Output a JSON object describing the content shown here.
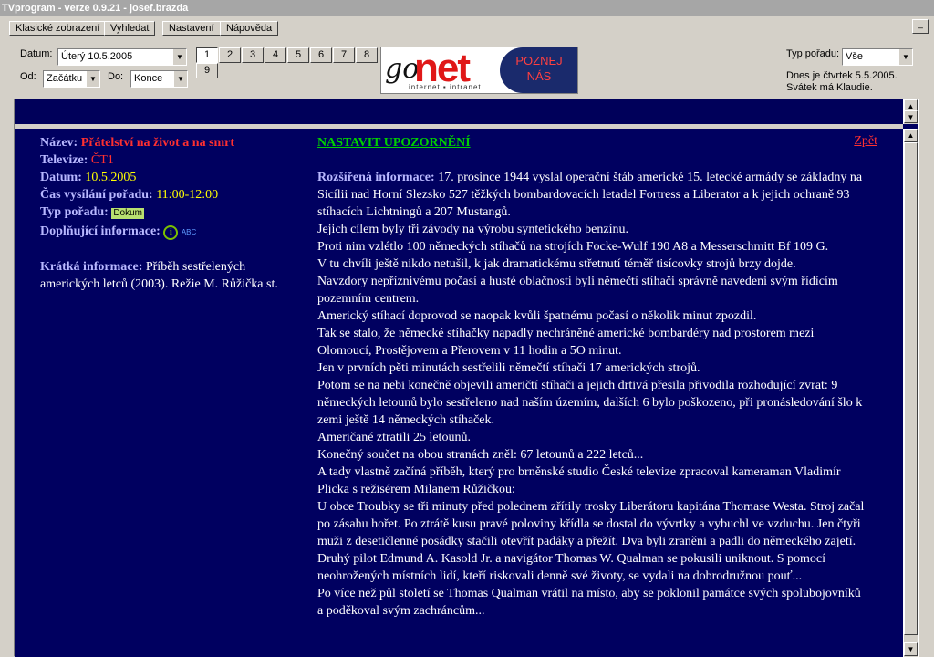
{
  "window": {
    "title": "TVprogram - verze 0.9.21 - josef.brazda"
  },
  "menu": [
    {
      "label": "Klasické zobrazení"
    },
    {
      "label": "Vyhledat"
    },
    {
      "label": "Nastavení"
    },
    {
      "label": "Nápověda"
    }
  ],
  "toolbar": {
    "datum_label": "Datum:",
    "datum_value": "Úterý 10.5.2005",
    "od_label": "Od:",
    "od_value": "Začátku",
    "do_label": "Do:",
    "do_value": "Konce",
    "days": [
      "1",
      "2",
      "3",
      "4",
      "5",
      "6",
      "7",
      "8",
      "9"
    ],
    "typ_label": "Typ pořadu:",
    "typ_value": "Vše",
    "today_line1": "Dnes je čtvrtek 5.5.2005.",
    "today_line2": "Svátek má Klaudie."
  },
  "logo": {
    "go": "go",
    "net": "net",
    "sub": "internet ▪ intranet",
    "poznej1": "POZNEJ",
    "poznej2": "NÁS"
  },
  "detail": {
    "nazev_label": "Název:",
    "nazev": "Přátelství na život a na smrt",
    "televize_label": "Televize:",
    "televize": "ČT1",
    "datum_label": "Datum:",
    "datum": "10.5.2005",
    "cas_label": "Čas vysílání pořadu:",
    "cas": "11:00-12:00",
    "typ_label": "Typ pořadu:",
    "typ_badge": "Dokum",
    "dopl_label": "Doplňující informace:",
    "abc": "ABC",
    "kratka_label": "Krátká informace:",
    "kratka": "Příběh sestřelených amerických letců (2003). Režie M. Růžička st.",
    "nastavit": "NASTAVIT UPOZORNĚNÍ",
    "zpet": "Zpět",
    "rozsirena_label": "Rozšířená informace:",
    "rozsirena": [
      "17. prosince 1944 vyslal operační štáb americké 15. letecké armády se základny na Sicílii nad Horní Slezsko 527 těžkých bombardovacích letadel Fortress a Liberator a k jejich ochraně 93 stíhacích Lichtningů a 207 Mustangů.",
      "Jejich cílem byly tři závody na výrobu syntetického benzínu.",
      "Proti nim vzlétlo 100 německých stíhačů na strojích Focke-Wulf 190 A8 a Messerschmitt Bf 109 G.",
      "V tu chvíli ještě nikdo netušil, k jak dramatickému střetnutí téměř tisícovky strojů brzy dojde.",
      "Navzdory nepříznivému počasí a husté oblačnosti byli němečtí stíhači správně navedeni svým řídícím pozemním centrem.",
      "Americký stíhací doprovod se naopak kvůli špatnému počasí o několik minut zpozdil.",
      "Tak se stalo, že německé stíhačky napadly nechráněné americké bombardéry nad prostorem mezi Olomoucí, Prostějovem a Přerovem v 11 hodin a 5O minut.",
      "Jen v prvních pěti minutách sestřelili němečtí stíhači 17 amerických strojů.",
      "Potom se na nebi konečně objevili američtí stíhači a jejich drtivá přesila přivodila rozhodující zvrat: 9 německých letounů bylo sestřeleno nad naším územím, dalších 6 bylo poškozeno, při pronásledování šlo k zemi ještě 14 německých stíhaček.",
      "Američané ztratili 25 letounů.",
      "Konečný součet na obou stranách zněl: 67 letounů a 222 letců...",
      "A tady vlastně začíná příběh, který pro brněnské studio České televize zpracoval kameraman Vladimír Plicka s režisérem Milanem Růžičkou:",
      "U obce Troubky se tři minuty před polednem zřítily trosky Liberátoru kapitána Thomase Westa. Stroj začal po zásahu hořet. Po ztrátě kusu pravé poloviny křídla se dostal do vývrtky a vybuchl ve vzduchu. Jen čtyři muži z desetičlenné posádky stačili otevřít padáky a přežít. Dva byli zraněni a padli do německého zajetí. Druhý pilot Edmund A. Kasold Jr. a navigátor Thomas W. Qualman se pokusili uniknout. S pomocí neohrožených místních lidí, kteří riskovali denně své životy, se vydali na dobrodružnou pouť...",
      "Po více než půl století se Thomas Qualman vrátil na místo, aby se poklonil památce svých spolubojovníků a poděkoval svým zachráncům..."
    ]
  }
}
